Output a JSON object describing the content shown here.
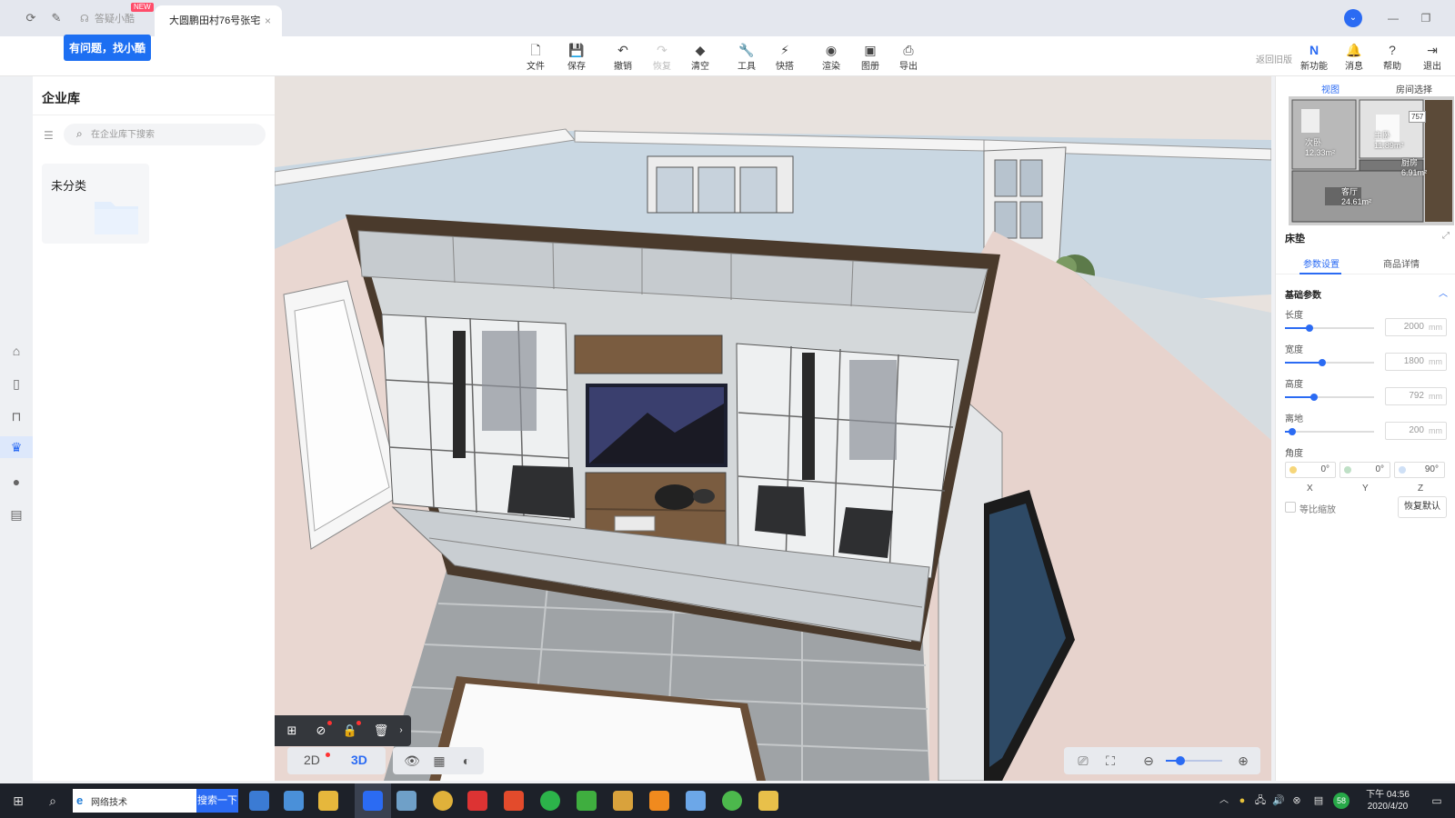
{
  "tabbar": {
    "tab_help_label": "答疑小酷",
    "tab_help_badge": "NEW",
    "tab_project_label": "大圆鹏田村76号张宅",
    "close_glyph": "×"
  },
  "help_bubble": "有问题，找小酷",
  "toolbar": {
    "items": [
      {
        "label": "文件",
        "icon": "file-icon"
      },
      {
        "label": "保存",
        "icon": "save-icon"
      },
      {
        "label": "撤销",
        "icon": "undo-icon"
      },
      {
        "label": "恢复",
        "icon": "redo-icon"
      },
      {
        "label": "清空",
        "icon": "eraser-icon"
      },
      {
        "label": "工具",
        "icon": "wrench-icon"
      },
      {
        "label": "快搭",
        "icon": "lightning-icon"
      },
      {
        "label": "渲染",
        "icon": "camera-icon"
      },
      {
        "label": "图册",
        "icon": "album-icon"
      },
      {
        "label": "导出",
        "icon": "export-icon"
      }
    ],
    "old_version": "返回旧版",
    "right_items": [
      {
        "label": "新功能",
        "icon": "new-feature-icon"
      },
      {
        "label": "消息",
        "icon": "bell-icon"
      },
      {
        "label": "帮助",
        "icon": "help-icon"
      },
      {
        "label": "退出",
        "icon": "logout-icon"
      }
    ]
  },
  "left_panel": {
    "title": "企业库",
    "search_placeholder": "在企业库下搜索",
    "folder_label": "未分类"
  },
  "view_controls": {
    "mode_2d": "2D",
    "mode_3d": "3D",
    "active_mode": "3D",
    "zoom_level": 0.25
  },
  "right_panel": {
    "tab_view": "视图",
    "tab_room": "房间选择",
    "map_labels": [
      {
        "name": "次卧",
        "area": "12.33m²"
      },
      {
        "name": "主卧",
        "area": "11.89m²"
      },
      {
        "name": "厨房",
        "area": "6.91m²"
      },
      {
        "name": "客厅",
        "area": "24.61m²"
      }
    ],
    "map_badge": "757",
    "object_name": "床垫",
    "subtab_params": "参数设置",
    "subtab_details": "商品详情",
    "section_title": "基础参数",
    "params": [
      {
        "label": "长度",
        "value": "2000",
        "unit": "mm",
        "level": 0.28
      },
      {
        "label": "宽度",
        "value": "1800",
        "unit": "mm",
        "level": 0.42
      },
      {
        "label": "高度",
        "value": "792",
        "unit": "mm",
        "level": 0.33
      },
      {
        "label": "离地",
        "value": "200",
        "unit": "mm",
        "level": 0.08
      }
    ],
    "angle_label": "角度",
    "angles": [
      {
        "axis": "X",
        "value": "0°"
      },
      {
        "axis": "Y",
        "value": "0°"
      },
      {
        "axis": "Z",
        "value": "90°"
      }
    ],
    "proportional_label": "等比缩放",
    "reset_label": "恢复默认"
  },
  "taskbar": {
    "search_value": "网络技术",
    "search_button": "搜索一下",
    "tray_badge": "58",
    "time": "下午 04:56",
    "date": "2020/4/20"
  },
  "colors": {
    "accent": "#2b6bf3",
    "taskbar": "#1d2129",
    "cabinet_frame": "#4a3a2c"
  }
}
